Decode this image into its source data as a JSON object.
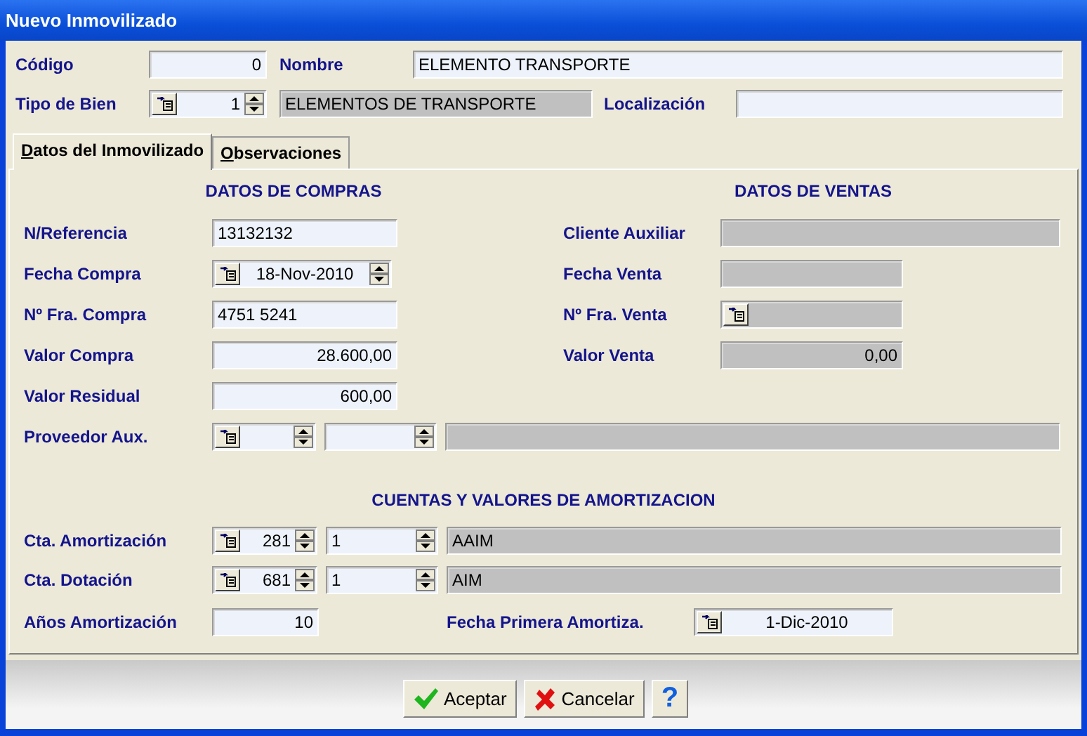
{
  "window": {
    "title": "Nuevo Inmovilizado"
  },
  "codigo": {
    "label": "Código",
    "field": {
      "kind": "text",
      "value": "0",
      "disabled": false
    }
  },
  "nombre": {
    "label": "Nombre",
    "field": {
      "kind": "text",
      "value": "ELEMENTO TRANSPORTE",
      "disabled": false
    }
  },
  "tipo_de_bien": {
    "label": "Tipo de Bien",
    "code": {
      "kind": "lookup_spin",
      "value": "1",
      "disabled": false
    },
    "description": {
      "kind": "text",
      "value": "ELEMENTOS DE TRANSPORTE",
      "disabled": true
    }
  },
  "localizacion": {
    "label": "Localización",
    "field": {
      "kind": "text",
      "disabled": false
    }
  },
  "tabs": [
    {
      "label": "Datos del Inmovilizado",
      "selected": true
    },
    {
      "label": "Observaciones",
      "selected": false
    }
  ],
  "compras": {
    "heading": "DATOS DE COMPRAS",
    "rows": [
      {
        "label": "N/Referencia",
        "field": {
          "kind": "text",
          "value": "13132132",
          "disabled": false
        }
      },
      {
        "label": "Fecha Compra",
        "field": {
          "kind": "lookup_spin",
          "value": "18-Nov-2010",
          "disabled": false
        }
      },
      {
        "label": "Nº Fra. Compra",
        "field": {
          "kind": "text",
          "value": "4751 5241",
          "disabled": false
        }
      },
      {
        "label": "Valor Compra",
        "field": {
          "kind": "text",
          "value": "28.600,00",
          "disabled": false
        }
      },
      {
        "label": "Valor Residual",
        "field": {
          "kind": "text",
          "value": "600,00",
          "disabled": false
        }
      }
    ]
  },
  "ventas": {
    "heading": "DATOS DE VENTAS",
    "rows": [
      {
        "label": "Cliente Auxiliar",
        "field": {
          "kind": "text",
          "disabled": true
        }
      },
      {
        "label": "Fecha Venta",
        "field": {
          "kind": "text",
          "disabled": true
        }
      },
      {
        "label": "Nº Fra. Venta",
        "field": {
          "kind": "lookup",
          "disabled": true
        }
      },
      {
        "label": "Valor Venta",
        "field": {
          "kind": "text",
          "value": "0,00",
          "disabled": true
        }
      }
    ]
  },
  "proveedor": {
    "label": "Proveedor Aux.",
    "fields": [
      {
        "kind": "lookup_spin",
        "disabled": false
      },
      {
        "kind": "spin",
        "disabled": false
      },
      {
        "kind": "text",
        "disabled": true
      }
    ]
  },
  "amortizacion": {
    "heading": "CUENTAS Y VALORES DE AMORTIZACION",
    "rows": [
      {
        "label": "Cta. Amortización",
        "fields": [
          {
            "kind": "lookup_spin",
            "value": "281",
            "disabled": false
          },
          {
            "kind": "spin",
            "value": "1",
            "disabled": false
          },
          {
            "kind": "text",
            "value": "AAIM",
            "disabled": true
          }
        ]
      },
      {
        "label": "Cta. Dotación",
        "fields": [
          {
            "kind": "lookup_spin",
            "value": "681",
            "disabled": false
          },
          {
            "kind": "spin",
            "value": "1",
            "disabled": false
          },
          {
            "kind": "text",
            "value": "AIM",
            "disabled": true
          }
        ]
      }
    ]
  },
  "anos_amortizacion": {
    "label": "Años Amortización",
    "field": {
      "kind": "text",
      "value": "10",
      "disabled": false
    }
  },
  "fecha_primera": {
    "label": "Fecha Primera Amortiza.",
    "field": {
      "kind": "lookup",
      "value": "1-Dic-2010",
      "disabled": false
    }
  },
  "buttons": [
    {
      "kind": "accept",
      "label": "Aceptar"
    },
    {
      "kind": "cancel",
      "label": "Cancelar"
    },
    {
      "kind": "help",
      "label": "?"
    }
  ]
}
